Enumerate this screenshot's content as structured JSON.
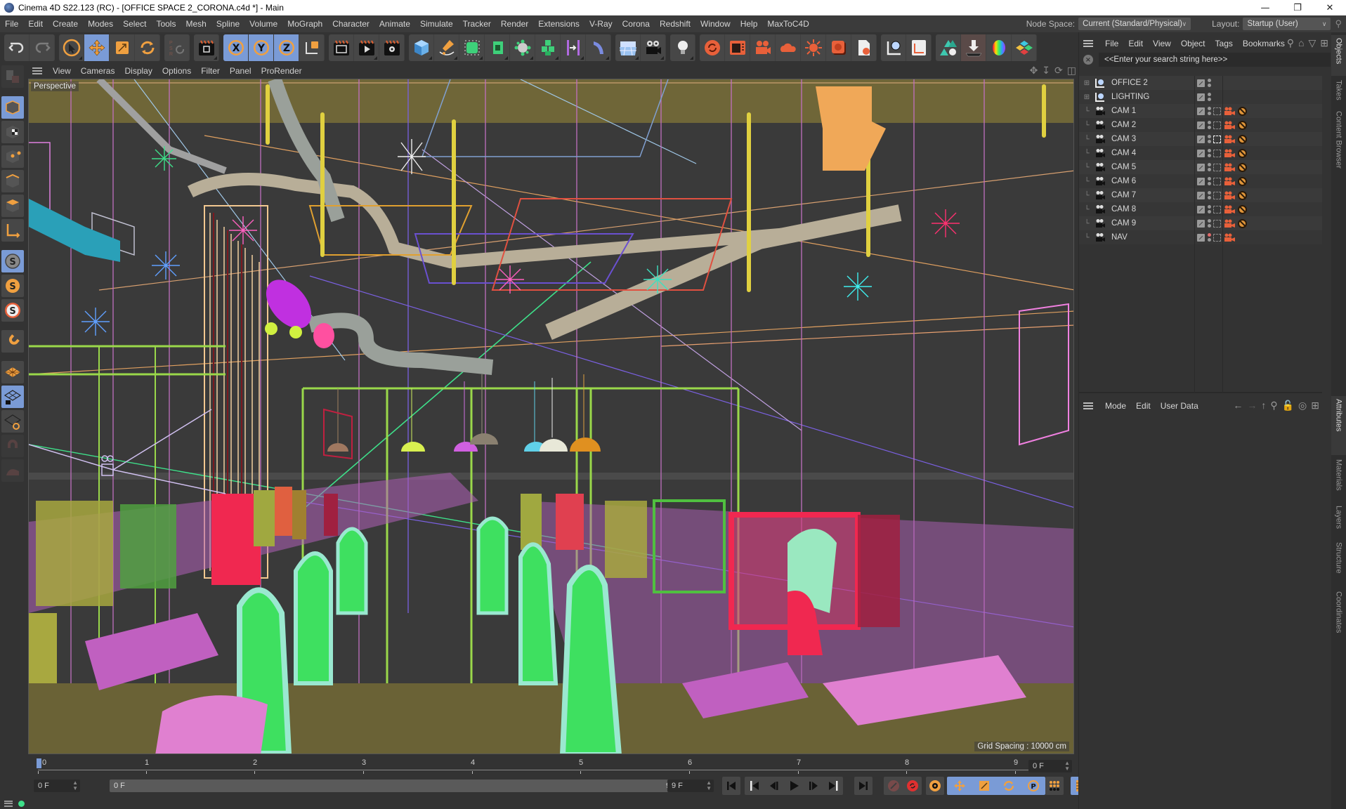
{
  "window": {
    "title": "Cinema 4D S22.123 (RC) - [OFFICE SPACE 2_CORONA.c4d *] - Main",
    "controls": [
      "minimize-icon",
      "restore-icon",
      "close-icon"
    ]
  },
  "menubar": {
    "items": [
      "File",
      "Edit",
      "Create",
      "Modes",
      "Select",
      "Tools",
      "Mesh",
      "Spline",
      "Volume",
      "MoGraph",
      "Character",
      "Animate",
      "Simulate",
      "Tracker",
      "Render",
      "Extensions",
      "V-Ray",
      "Corona",
      "Redshift",
      "Window",
      "Help",
      "MaxToC4D"
    ],
    "node_space_label": "Node Space:",
    "node_space_value": "Current (Standard/Physical)",
    "layout_label": "Layout:",
    "layout_value": "Startup (User)"
  },
  "toolbar": {
    "groups": [
      [
        "undo-icon",
        "redo-icon"
      ],
      [
        "live-selection-icon",
        "move-icon",
        "scale-icon",
        "rotate-icon"
      ],
      [
        "psr-icon"
      ],
      [
        "render-region-icon"
      ],
      [
        "x-axis-icon",
        "y-axis-icon",
        "z-axis-icon",
        "coordinate-system-icon"
      ],
      [
        "render-view-icon",
        "render-to-picture-viewer-icon",
        "render-settings-icon"
      ],
      [
        "cube-icon",
        "pen-icon",
        "subdivision-icon",
        "extrude-icon",
        "mograph-cloner-icon",
        "voronoi-icon",
        "deformer-icon",
        "bend-icon"
      ],
      [
        "floor-icon",
        "camera-icon"
      ],
      [
        "light-icon"
      ],
      [
        "corona-ipr-icon",
        "corona-vfb-icon",
        "corona-camera-icon",
        "corona-sky-icon",
        "corona-sun-icon",
        "corona-material-icon",
        "corona-settings-icon"
      ],
      [
        "null-object-icon",
        "coordinate-icon"
      ],
      [
        "proxy-icon",
        "drop-to-floor-icon",
        "color-icon",
        "maxtoc4d-icon"
      ]
    ]
  },
  "left_tools": [
    "make-editable-icon",
    "model-mode-icon",
    "texture-mode-icon",
    "points-mode-icon",
    "edges-mode-icon",
    "polygons-mode-icon",
    "axis-mode-icon",
    "solo-off-icon",
    "solo-single-icon",
    "solo-hierarchy-icon",
    "snap-icon",
    "workplane-icon",
    "lock-workplane-icon",
    "align-workplane-icon",
    "magnet-icon",
    "sculpt-icon"
  ],
  "viewport": {
    "menu": [
      "View",
      "Cameras",
      "Display",
      "Options",
      "Filter",
      "Panel",
      "ProRender"
    ],
    "label": "Perspective",
    "grid_spacing": "Grid Spacing : 10000 cm",
    "nav_icons": [
      "move-view-icon",
      "zoom-view-icon",
      "rotate-view-icon",
      "toggle-view-icon"
    ]
  },
  "timeline": {
    "ticks": [
      "0",
      "1",
      "2",
      "3",
      "4",
      "5",
      "6",
      "7",
      "8",
      "9"
    ],
    "current_frame_field": "0 F",
    "start_field": "0 F",
    "range_start": "0 F",
    "range_end": "9 F",
    "end_field": "9 F",
    "current_frame": 0
  },
  "transport": [
    "go-to-start-icon",
    "prev-key-icon",
    "prev-frame-icon",
    "play-icon",
    "next-frame-icon",
    "next-key-icon",
    "go-to-end-icon",
    "record-icon",
    "autokey-icon",
    "keyframe-settings-icon",
    "move-key-icon",
    "scale-key-icon",
    "rotate-key-icon",
    "param-key-icon",
    "point-level-icon",
    "timeline-icon"
  ],
  "objects_panel": {
    "menu": [
      "File",
      "Edit",
      "View",
      "Object",
      "Tags",
      "Bookmarks"
    ],
    "search_placeholder": "<<Enter your search string here>>",
    "objects": [
      {
        "name": "OFFICE 2",
        "type": "null",
        "expandable": true,
        "has_tags": false
      },
      {
        "name": "LIGHTING",
        "type": "null",
        "expandable": true,
        "has_tags": false
      },
      {
        "name": "CAM 1",
        "type": "camera",
        "has_tags": true,
        "protect": true
      },
      {
        "name": "CAM 2",
        "type": "camera",
        "has_tags": true,
        "protect": true
      },
      {
        "name": "CAM 3",
        "type": "camera",
        "has_tags": true,
        "protect": true,
        "active": true
      },
      {
        "name": "CAM 4",
        "type": "camera",
        "has_tags": true,
        "protect": true
      },
      {
        "name": "CAM 5",
        "type": "camera",
        "has_tags": true,
        "protect": true
      },
      {
        "name": "CAM 6",
        "type": "camera",
        "has_tags": true,
        "protect": true
      },
      {
        "name": "CAM 7",
        "type": "camera",
        "has_tags": true,
        "protect": true
      },
      {
        "name": "CAM 8",
        "type": "camera",
        "has_tags": true,
        "protect": true
      },
      {
        "name": "CAM 9",
        "type": "camera",
        "has_tags": true,
        "protect": true
      },
      {
        "name": "NAV",
        "type": "camera",
        "has_tags": true,
        "protect": false,
        "editor_red": true
      }
    ]
  },
  "attributes_panel": {
    "menu": [
      "Mode",
      "Edit",
      "User Data"
    ]
  },
  "side_tabs_top": [
    "Objects",
    "Takes",
    "Content Browser"
  ],
  "side_tabs_bottom": [
    "Attributes",
    "Materials",
    "Layers",
    "Structure",
    "Coordinates"
  ],
  "colors": {
    "accent": "#7a9bd6",
    "orange_icon": "#f0a040",
    "corona_red": "#e8603a",
    "status_green": "#3ee08a"
  }
}
